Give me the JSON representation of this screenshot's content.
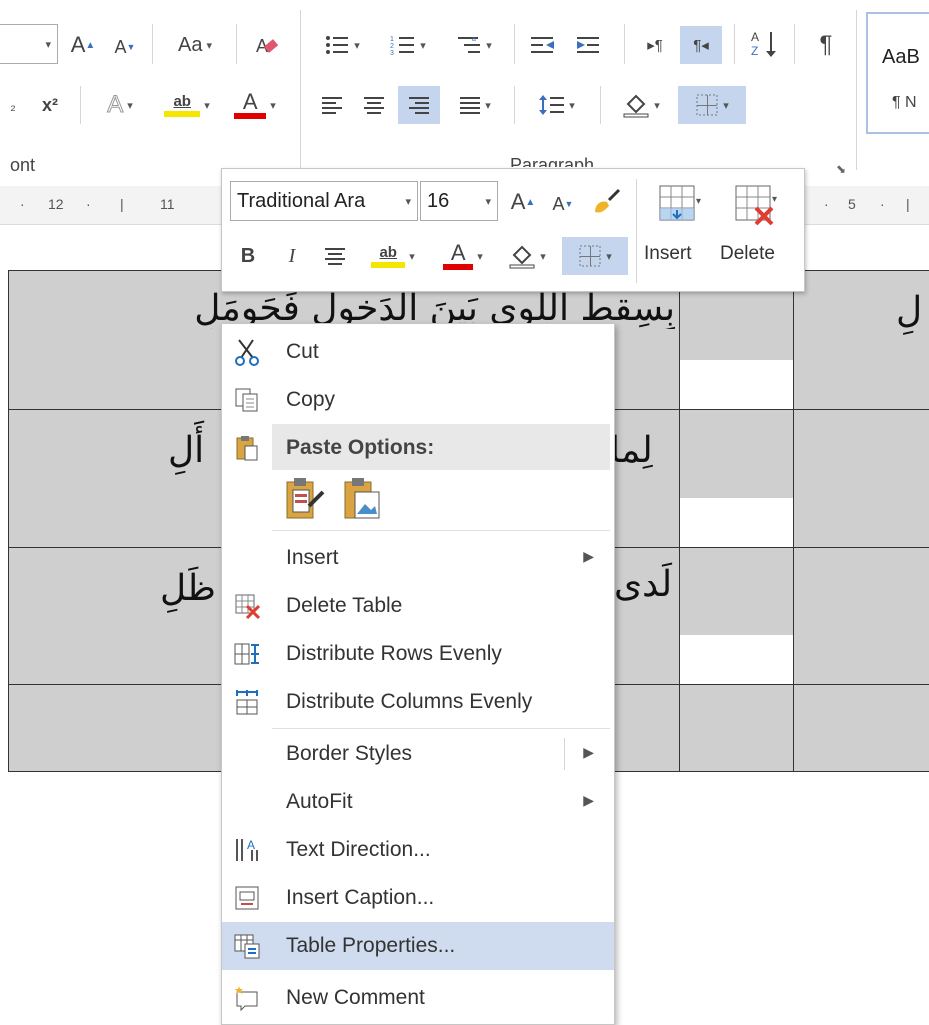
{
  "ribbon": {
    "font_group_label": "ont",
    "paragraph_group_label": "Paragraph",
    "styles_preview_top": "AaB",
    "styles_preview_bottom": "¶ N",
    "font_size_fragment": "",
    "buttons": {
      "grow_font": "A",
      "shrink_font": "A",
      "change_case": "Aa",
      "superscript": "x²",
      "subscript": "₂",
      "text_effects": "A",
      "highlight": "ab",
      "font_color": "A",
      "show_marks": "¶"
    }
  },
  "ruler": {
    "numbers": [
      "12",
      "11",
      "5"
    ]
  },
  "document": {
    "rows": [
      {
        "text": "بِسِقطِ اللِوى بَينَ الدَخولِ فَحَومَلِ",
        "right_fragment": "لِ"
      },
      {
        "text": "لِما نَسَجَتها مِن جَنوبٍ وَشَمأَلِ",
        "left_fragment": "أَلِ",
        "right_fragment": "لِما"
      },
      {
        "text": "لَدى سَمُراتِ الحَيِّ ناقِفُ حَنظَلِ",
        "left_fragment": "ظَلِ",
        "right_fragment": "لَدى"
      },
      {
        "text": ""
      }
    ]
  },
  "mini_toolbar": {
    "font_name": "Traditional Ara",
    "font_size": "16",
    "bold": "B",
    "italic": "I",
    "grow_font": "A",
    "shrink_font": "A",
    "insert_label": "Insert",
    "delete_label": "Delete",
    "highlight": "ab",
    "font_color": "A"
  },
  "context_menu": {
    "items": [
      {
        "label": "Cut",
        "icon": "scissors-icon"
      },
      {
        "label": "Copy",
        "icon": "copy-icon"
      },
      {
        "label": "Paste Options:",
        "icon": "clipboard-icon"
      },
      {
        "label": "Insert",
        "submenu": true
      },
      {
        "label": "Delete Table",
        "icon": "delete-table-icon"
      },
      {
        "label": "Distribute Rows Evenly",
        "icon": "distribute-rows-icon"
      },
      {
        "label": "Distribute Columns Evenly",
        "icon": "distribute-columns-icon"
      },
      {
        "label": "Border Styles",
        "submenu": true
      },
      {
        "label": "AutoFit",
        "submenu": true
      },
      {
        "label": "Text Direction...",
        "icon": "text-direction-icon"
      },
      {
        "label": "Insert Caption...",
        "icon": "insert-caption-icon"
      },
      {
        "label": "Table Properties...",
        "icon": "table-properties-icon",
        "highlighted": true
      },
      {
        "label": "New Comment",
        "icon": "new-comment-icon"
      }
    ]
  },
  "colors": {
    "accent_selected": "#c5d5ee",
    "menu_highlight": "#cfdcf0",
    "highlight_yellow": "#f5e600",
    "font_red": "#e00000",
    "table_gray": "#cfcfcf"
  }
}
